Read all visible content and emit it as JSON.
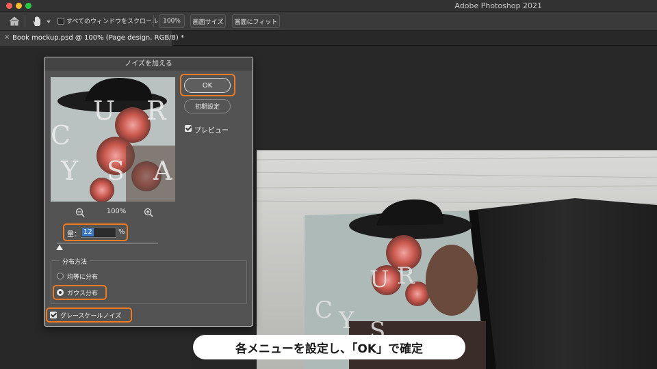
{
  "app": {
    "title": "Adobe Photoshop 2021"
  },
  "options_bar": {
    "scroll_all_windows_label": "すべてのウィンドウをスクロール",
    "scroll_all_windows_checked": false,
    "zoom_100_label": "100%",
    "fit_screen_label": "画面サイズ",
    "fill_screen_label": "画面にフィット"
  },
  "document_tab": {
    "close_glyph": "×",
    "title": "Book mockup.psd @ 100% (Page design, RGB/8) *"
  },
  "dialog": {
    "title": "ノイズを加える",
    "ok_label": "OK",
    "reset_label": "初期設定",
    "preview_label": "プレビュー",
    "preview_checked": true,
    "zoom_level": "100%",
    "amount_label": "量：",
    "amount_value": "12",
    "amount_unit": "%",
    "amount_slider_fraction": 0.03,
    "distribution_label": "分布方法",
    "distribution_options": [
      "均等に分布",
      "ガウス分布"
    ],
    "distribution_selected": "ガウス分布",
    "monochromatic_label": "グレースケールノイズ",
    "monochromatic_checked": true
  },
  "highlight_color": "#ee7a24",
  "caption": {
    "text": "各メニューを設定し、「OK」で確定"
  }
}
